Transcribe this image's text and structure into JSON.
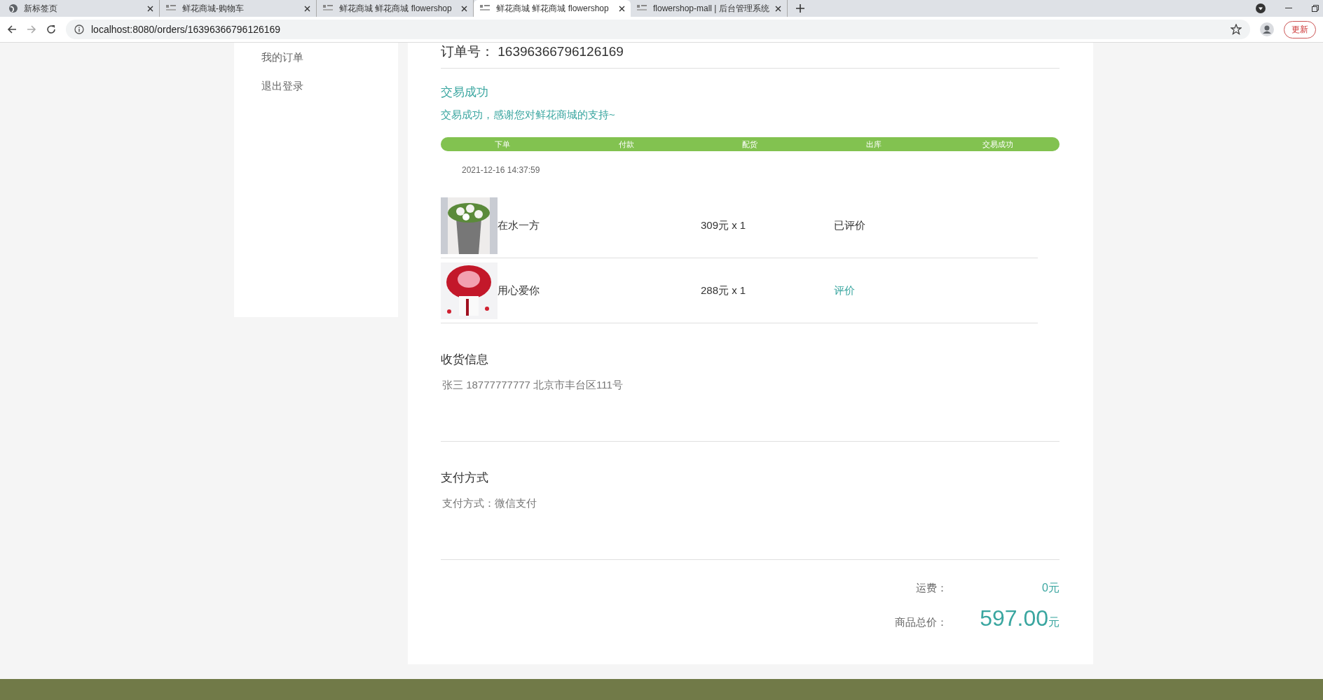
{
  "browser": {
    "tabs": [
      {
        "title": "新标签页",
        "kind": "globe",
        "selected": false
      },
      {
        "title": "鲜花商城-购物车",
        "kind": "logo",
        "selected": false
      },
      {
        "title": "鲜花商城 鲜花商城 flowershop",
        "kind": "logo",
        "selected": false
      },
      {
        "title": "鲜花商城 鲜花商城 flowershop",
        "kind": "logo",
        "selected": true
      },
      {
        "title": "flowershop-mall | 后台管理系统",
        "kind": "logo",
        "selected": false
      }
    ],
    "address": "localhost:8080/orders/16396366796126169",
    "update_button": "更新"
  },
  "sidebar": {
    "items": [
      "我的订单",
      "退出登录"
    ]
  },
  "order": {
    "number_label": "订单号：",
    "number": "16396366796126169",
    "status_title": "交易成功",
    "status_message": "交易成功，感谢您对鲜花商城的支持~",
    "progress": {
      "level": 1
    },
    "steps": [
      "下单",
      "付款",
      "配货",
      "出库",
      "交易成功"
    ],
    "time": "2021-12-16 14:37:59",
    "items": [
      {
        "name": "在水一方",
        "price": "309元 x 1",
        "review": "已评价",
        "kind": "done"
      },
      {
        "name": "用心爱你",
        "price": "288元 x 1",
        "review": "评价",
        "kind": "link"
      }
    ]
  },
  "shipping": {
    "title": "收货信息",
    "text": "张三 18777777777 北京市丰台区111号"
  },
  "payment": {
    "title": "支付方式",
    "text": "支付方式：微信支付"
  },
  "totals": {
    "shipping_label": "运费：",
    "shipping_value": "0",
    "shipping_unit": "元",
    "total_label": "商品总价：",
    "total_value": "597.00",
    "total_unit": "元"
  }
}
